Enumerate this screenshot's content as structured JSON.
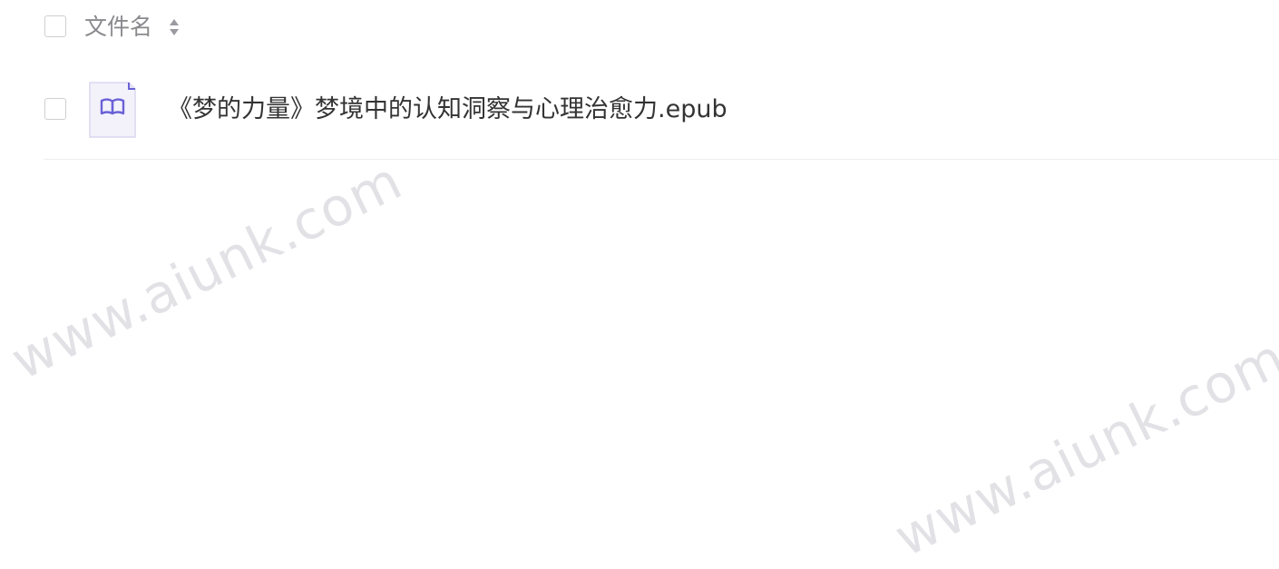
{
  "table": {
    "header": {
      "column_label": "文件名",
      "sort_icon": "sort-icon"
    },
    "rows": [
      {
        "name": "《梦的力量》梦境中的认知洞察与心理治愈力.epub",
        "icon": "epub-book-icon",
        "icon_color": "#6b62d6"
      }
    ]
  },
  "watermark_text": "www.aiunk.com",
  "colors": {
    "header_text": "#8a8a8e",
    "file_text": "#333333",
    "icon_accent": "#6b62d6",
    "icon_bg": "#f3f2fb",
    "divider": "#eeeef0"
  }
}
